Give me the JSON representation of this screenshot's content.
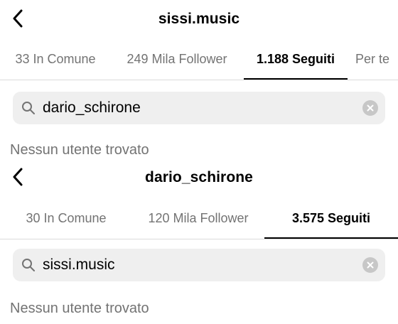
{
  "panels": [
    {
      "title": "sissi.music",
      "tabs": [
        "33 In Comune",
        "249 Mila Follower",
        "1.188 Seguiti",
        "Per te"
      ],
      "active_tab": 2,
      "search_value": "dario_schirone",
      "empty_message": "Nessun utente trovato"
    },
    {
      "title": "dario_schirone",
      "tabs": [
        "30 In Comune",
        "120 Mila Follower",
        "3.575 Seguiti"
      ],
      "active_tab": 2,
      "search_value": "sissi.music",
      "empty_message": "Nessun utente trovato"
    }
  ],
  "icons": {
    "back": "chevron-left-icon",
    "search": "search-icon",
    "clear": "clear-x-icon"
  },
  "colors": {
    "text": "#000000",
    "secondary_text": "#737373",
    "search_background": "#efefef",
    "divider": "#dbdbdb",
    "clear_button": "#c7c7c7"
  }
}
